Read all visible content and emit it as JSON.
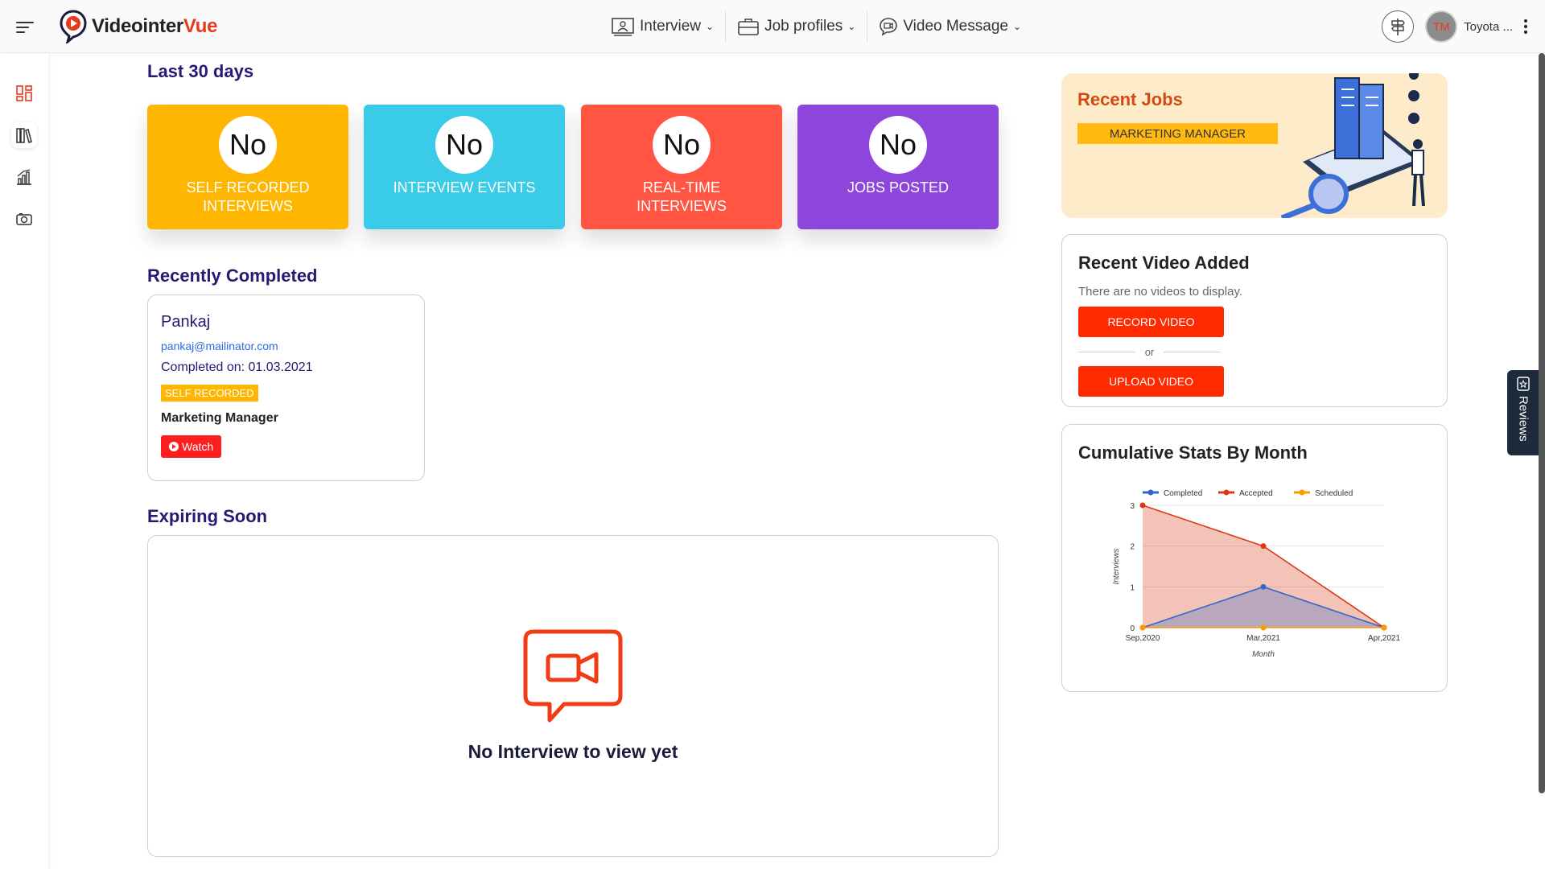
{
  "header": {
    "logo_part1": "Videointer",
    "logo_part2": "Vue",
    "nav": [
      {
        "label": "Interview",
        "icon": "interview-icon"
      },
      {
        "label": "Job profiles",
        "icon": "briefcase-icon"
      },
      {
        "label": "Video Message",
        "icon": "video-message-icon"
      }
    ],
    "user": {
      "initials": "TM",
      "name": "Toyota ..."
    }
  },
  "sidebar": {
    "items": [
      {
        "icon": "dashboard-icon",
        "active": false
      },
      {
        "icon": "library-icon",
        "active": true
      },
      {
        "icon": "analytics-icon",
        "active": false
      },
      {
        "icon": "camera-icon",
        "active": false
      }
    ]
  },
  "main": {
    "last30_title": "Last 30 days",
    "stats": [
      {
        "value": "No",
        "label": "SELF RECORDED INTERVIEWS",
        "color": "#ffb600"
      },
      {
        "value": "No",
        "label": "INTERVIEW EVENTS",
        "color": "#3acbe8"
      },
      {
        "value": "No",
        "label": "REAL-TIME INTERVIEWS",
        "color": "#ff5542"
      },
      {
        "value": "No",
        "label": "JOBS POSTED",
        "color": "#8c46dc"
      }
    ],
    "recently_completed_title": "Recently Completed",
    "recently_completed": {
      "name": "Pankaj",
      "email": "pankaj@mailinator.com",
      "completed": "Completed on: 01.03.2021",
      "badge": "SELF RECORDED",
      "job": "Marketing Manager",
      "watch": "Watch"
    },
    "expiring_title": "Expiring Soon",
    "expiring_empty": "No Interview to view yet"
  },
  "right": {
    "recent_jobs_title": "Recent Jobs",
    "recent_job": "MARKETING MANAGER",
    "recent_video_title": "Recent Video Added",
    "recent_video_text": "There are no videos to display.",
    "record_btn": "RECORD VIDEO",
    "or": "or",
    "upload_btn": "UPLOAD VIDEO",
    "stats_title": "Cumulative Stats By Month"
  },
  "reviews_tab": "Reviews",
  "chart_data": {
    "type": "area",
    "categories": [
      "Sep,2020",
      "Mar,2021",
      "Apr,2021"
    ],
    "series": [
      {
        "name": "Completed",
        "values": [
          0,
          1,
          0
        ],
        "color": "#3366cc"
      },
      {
        "name": "Accepted",
        "values": [
          3,
          2,
          0
        ],
        "color": "#dc3912"
      },
      {
        "name": "Scheduled",
        "values": [
          0,
          0,
          0
        ],
        "color": "#ff9900"
      }
    ],
    "xlabel": "Month",
    "ylabel": "Interviews",
    "ylim": [
      0,
      3
    ],
    "yticks": [
      "0",
      "1",
      "2",
      "3"
    ],
    "legend": "top"
  }
}
